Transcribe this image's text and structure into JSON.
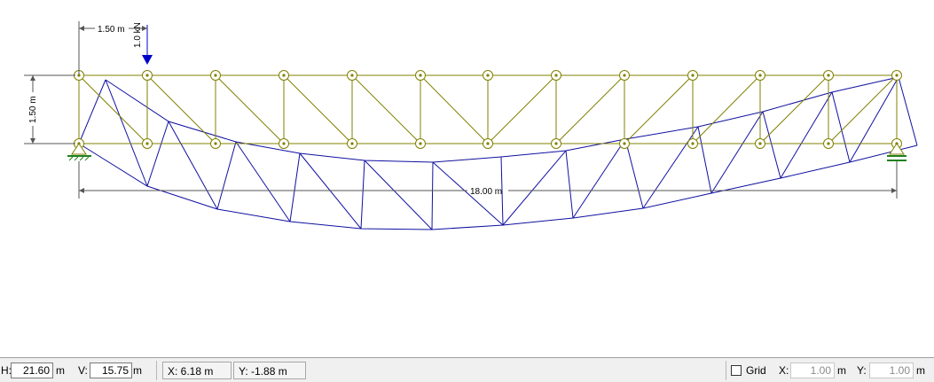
{
  "drawing": {
    "top_spacing_label": "1.50 m",
    "height_label": "1.50 m",
    "span_label": "18.00 m",
    "load_label": "1.0 kN",
    "colors": {
      "truss": "#808000",
      "deformed": "#1010a0",
      "load": "#0000cc",
      "support_hatch": "#208020",
      "dimension": "#555555"
    }
  },
  "statusbar": {
    "h_label": "H:",
    "h_value": "21.60",
    "h_unit": "m",
    "v_label": "V:",
    "v_value": "15.75",
    "v_unit": "m",
    "x_readout": "X: 6.18 m",
    "y_readout": "Y: -1.88 m",
    "grid_label": "Grid",
    "grid_checked": false,
    "grid_x_label": "X:",
    "grid_x_value": "1.00",
    "grid_x_unit": "m",
    "grid_y_label": "Y:",
    "grid_y_value": "1.00",
    "grid_y_unit": "m"
  }
}
